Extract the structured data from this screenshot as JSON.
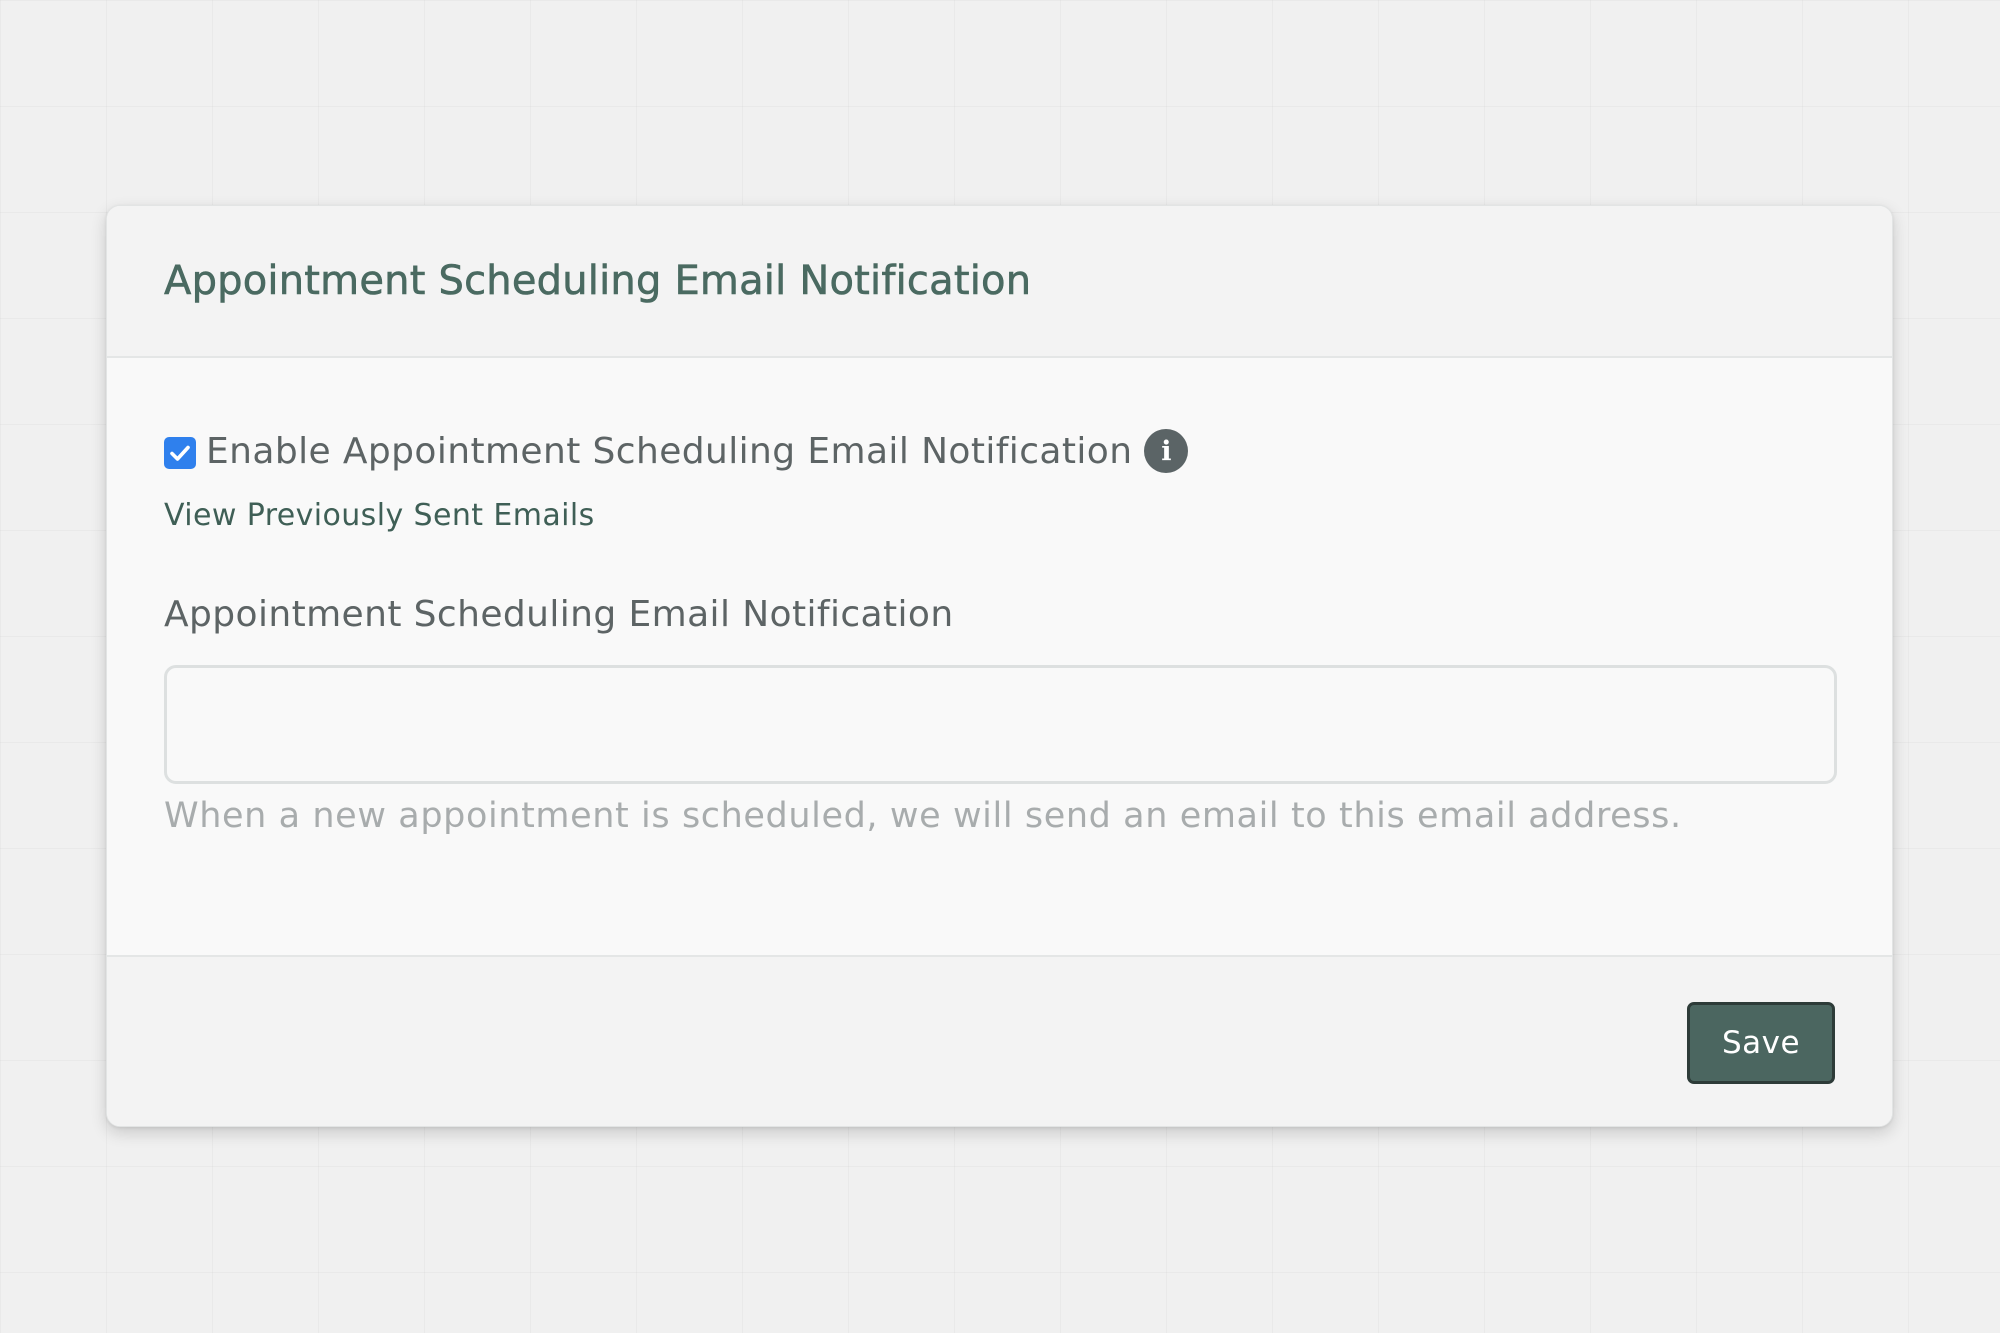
{
  "colors": {
    "accent": "#4b6660",
    "title": "#4a6a61",
    "link": "#3f5f56",
    "checkbox": "#2f80ed",
    "help_text": "#a8acad",
    "info_icon": "#5b6466"
  },
  "card": {
    "title": "Appointment Scheduling Email Notification",
    "enable_checkbox": {
      "label": "Enable Appointment Scheduling Email Notification",
      "checked": true,
      "icon": "check-icon"
    },
    "info_icon": {
      "glyph": "i",
      "icon": "info-icon"
    },
    "view_link": "View Previously Sent Emails",
    "email_field": {
      "label": "Appointment Scheduling Email Notification",
      "value": "",
      "placeholder": ""
    },
    "help_text": "When a new appointment is scheduled, we will send an email to this email address.",
    "save_label": "Save"
  }
}
